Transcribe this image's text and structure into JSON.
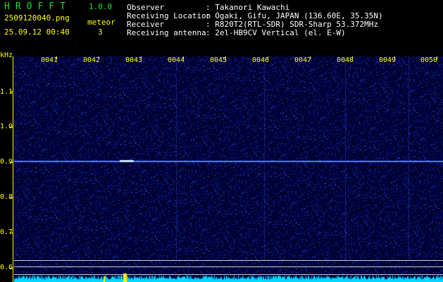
{
  "header": {
    "app_name": "HROFFT",
    "version": "1.0.0",
    "filename": "2509120040.png",
    "datetime": "25.09.12 00:40",
    "meteor_label": "meteor",
    "meteor_count": "3",
    "info_labels": [
      "Observer",
      "Receiving Location",
      "Receiver",
      "Receiving antenna"
    ],
    "info_values": [
      ": Takanori Kawachi",
      ": Ogaki, Gifu, JAPAN (136.60E, 35.35N)",
      ": R820T2(RTL-SDR) SDR-Sharp 53.372MHz",
      ": 2el-HB9CV Vertical (el. E-W)"
    ]
  },
  "axis": {
    "unit": "kHz",
    "y_labels": [
      "1.1",
      "1.0",
      "0.9",
      "0.8",
      "0.7",
      "0.6"
    ],
    "x_labels": [
      "0041",
      "0042",
      "0043",
      "0044",
      "0045",
      "0046",
      "0047",
      "0048",
      "0049",
      "0050"
    ]
  },
  "colors": {
    "background": "#000000",
    "waterfall_base": "#05054a",
    "signal_line": "#5a7cff",
    "spectrum": "#00d8ff",
    "axis": "#ffff00",
    "title": "#22dd22"
  }
}
